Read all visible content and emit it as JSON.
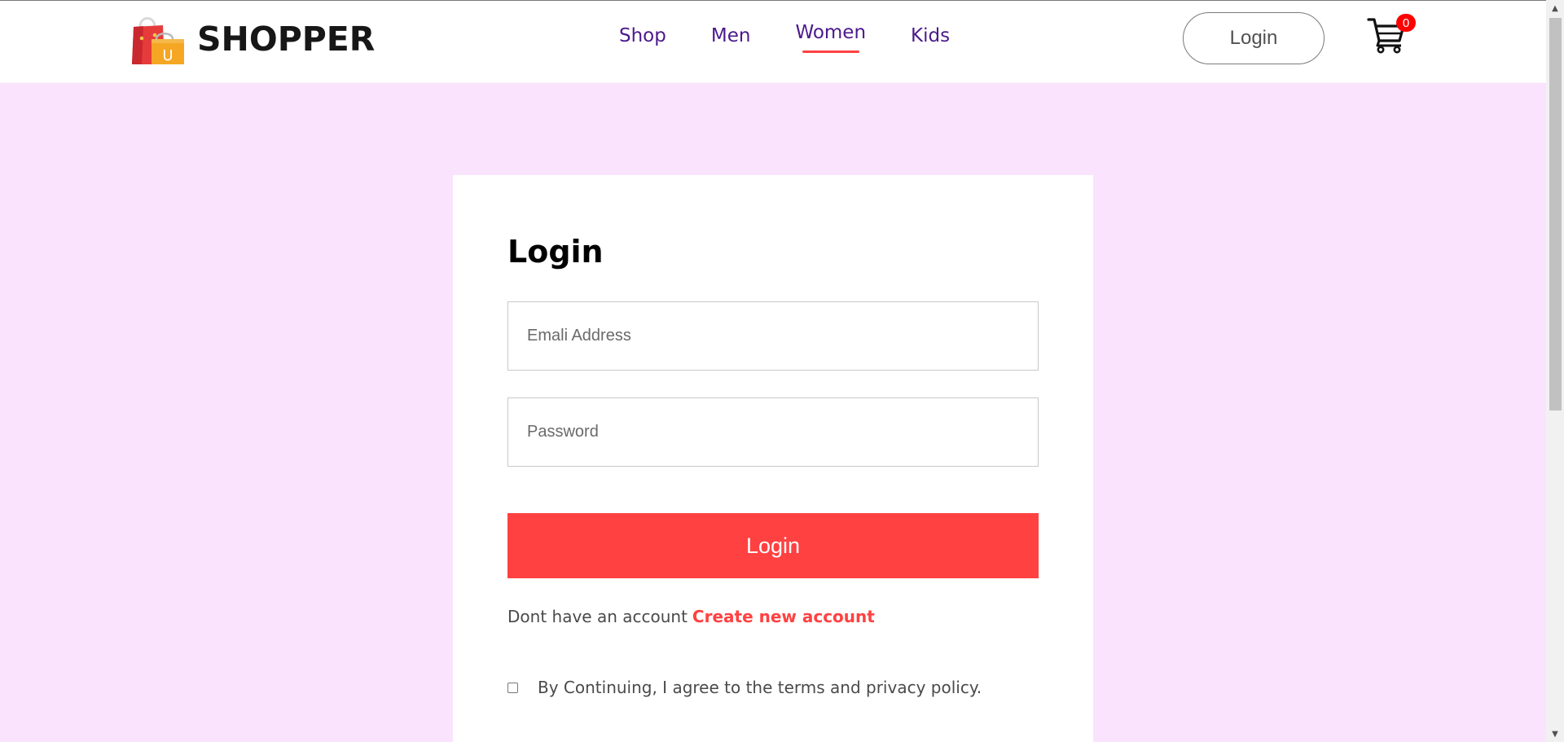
{
  "brand": {
    "name": "SHOPPER",
    "logo_letter": "U"
  },
  "nav": {
    "items": [
      {
        "label": "Shop"
      },
      {
        "label": "Men"
      },
      {
        "label": "Women",
        "active": true
      },
      {
        "label": "Kids"
      }
    ]
  },
  "header": {
    "login_label": "Login",
    "cart_count": "0"
  },
  "login_form": {
    "title": "Login",
    "email_placeholder": "Emali Address",
    "password_placeholder": "Password",
    "submit_label": "Login",
    "signup_prompt": "Dont have an account",
    "signup_link": "Create new account",
    "terms_text": "By Continuing, I agree to the terms and privacy policy.",
    "terms_checked": false
  },
  "colors": {
    "accent": "#ff4141",
    "nav_text": "#4b1a8c",
    "page_bg": "#fae3fd"
  },
  "icons": [
    "shopping-bag-logo-icon",
    "cart-icon",
    "scroll-up-arrow-icon",
    "scroll-down-arrow-icon"
  ]
}
